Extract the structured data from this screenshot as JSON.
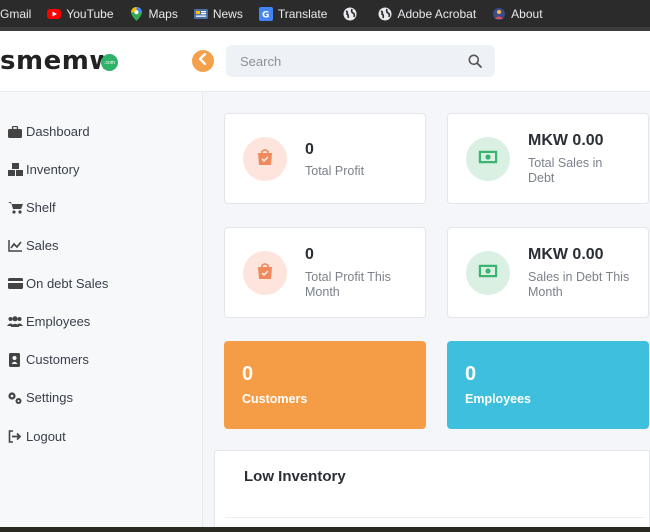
{
  "bookmarks": [
    {
      "label": "Gmail",
      "icon": "gmail-icon"
    },
    {
      "label": "YouTube",
      "icon": "youtube-icon"
    },
    {
      "label": "Maps",
      "icon": "maps-icon"
    },
    {
      "label": "News",
      "icon": "news-icon"
    },
    {
      "label": "Translate",
      "icon": "translate-icon"
    },
    {
      "label": "",
      "icon": "globe-icon"
    },
    {
      "label": "Adobe Acrobat",
      "icon": "globe-icon"
    },
    {
      "label": "About",
      "icon": "about-icon"
    }
  ],
  "header": {
    "logo": "smemw",
    "logo_badge": ".com",
    "search_placeholder": "Search"
  },
  "sidebar": {
    "items": [
      {
        "label": "Dashboard",
        "icon": "briefcase-icon"
      },
      {
        "label": "Inventory",
        "icon": "boxes-icon"
      },
      {
        "label": "Shelf",
        "icon": "cart-icon"
      },
      {
        "label": "Sales",
        "icon": "chart-line-icon"
      },
      {
        "label": "On debt Sales",
        "icon": "credit-card-icon"
      },
      {
        "label": "Employees",
        "icon": "users-icon"
      },
      {
        "label": "Customers",
        "icon": "address-book-icon"
      },
      {
        "label": "Settings",
        "icon": "cogs-icon"
      },
      {
        "label": "Logout",
        "icon": "logout-icon"
      }
    ]
  },
  "stats": {
    "total_profit": {
      "value": "0",
      "label": "Total Profit"
    },
    "total_sales_debt": {
      "value": "MKW 0.00",
      "label_line1": "Total Sales in",
      "label_line2": "Debt"
    },
    "profit_month": {
      "value": "0",
      "label_line1": "Total Profit This",
      "label_line2": "Month"
    },
    "sales_debt_month": {
      "value": "MKW 0.00",
      "label_line1": "Sales in Debt This",
      "label_line2": "Month"
    },
    "customers": {
      "value": "0",
      "label": "Customers"
    },
    "employees": {
      "value": "0",
      "label": "Employees"
    }
  },
  "low_inventory": {
    "title": "Low Inventory"
  },
  "colors": {
    "accent_orange": "#f59d46",
    "accent_cyan": "#3dbfdd",
    "icon_orange": "#f08a5d",
    "icon_green": "#3cb371"
  }
}
